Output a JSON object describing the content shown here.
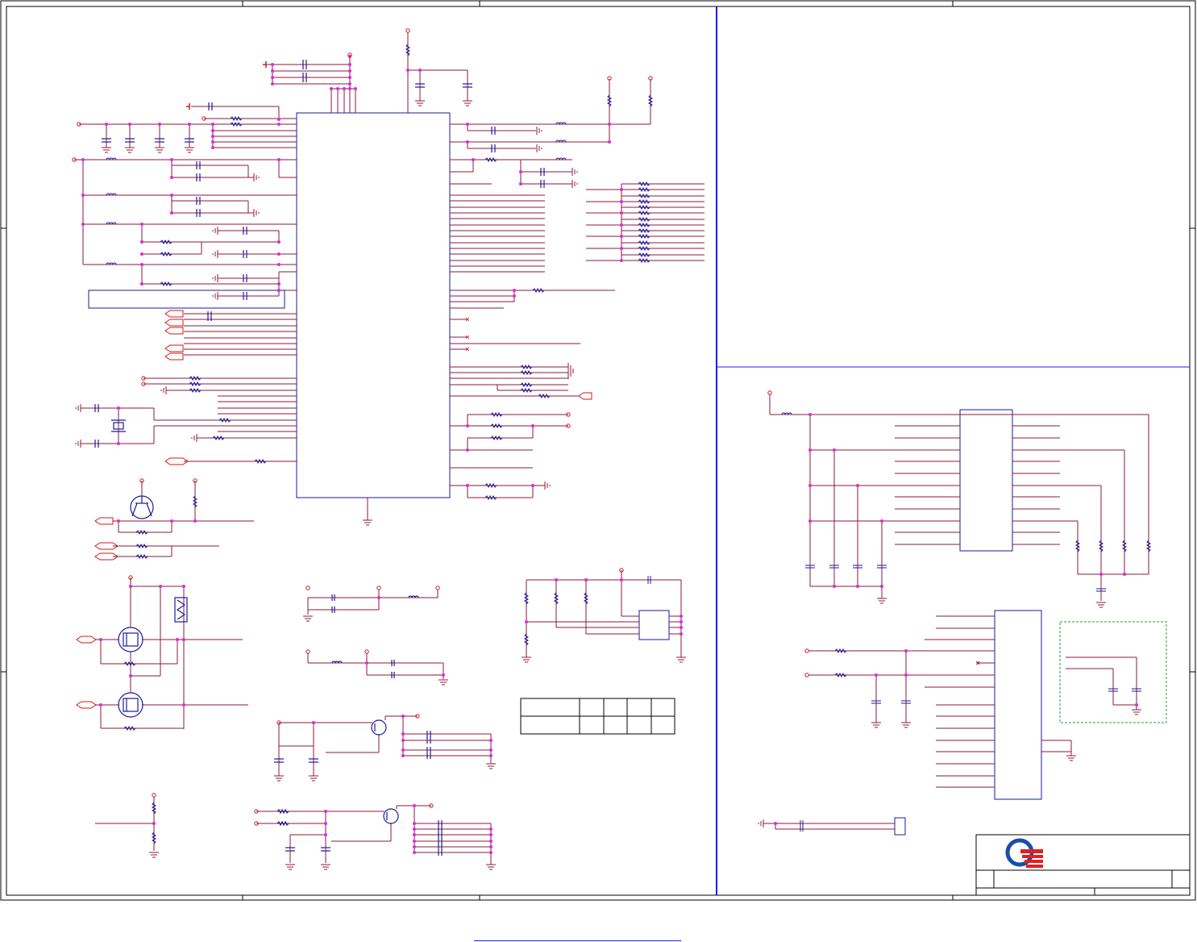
{
  "colors": {
    "wire": "#8b1a3a",
    "component": "#1a1a9c",
    "junction": "#d82cd8",
    "border": "#1a1aff",
    "frame": "#000000",
    "power": "#d01818",
    "group_box": "#2a9c2a",
    "logo_blue": "#1a4fa8",
    "logo_red": "#e02020"
  },
  "icons": {
    "logo": "company-logo-icon",
    "ground": "ground-symbol-icon",
    "power": "power-port-icon",
    "resistor": "resistor-icon",
    "capacitor": "capacitor-icon",
    "inductor": "inductor-icon",
    "transistor": "transistor-icon",
    "mosfet": "mosfet-icon",
    "crystal": "crystal-icon"
  },
  "title_block": {
    "logo_colors": [
      "#1a4fa8",
      "#e02020"
    ]
  },
  "footer": {
    "link_text": ""
  }
}
